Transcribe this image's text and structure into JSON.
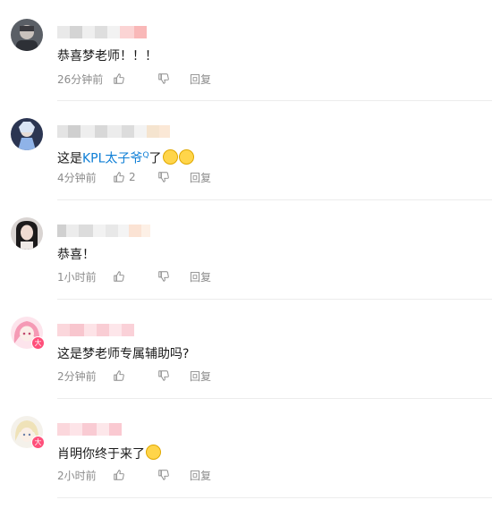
{
  "comments": [
    {
      "text": "恭喜梦老师！！！",
      "time": "26分钟前",
      "likes": "",
      "reply_label": "回复"
    },
    {
      "text_prefix": "这是",
      "link_text": "KPL太子爷",
      "link_sup": "Q",
      "text_suffix": "了",
      "emojis": [
        "smiling-emoji",
        "smiling-emoji"
      ],
      "time": "4分钟前",
      "likes": "2",
      "reply_label": "回复"
    },
    {
      "text": "恭喜！",
      "time": "1小时前",
      "likes": "",
      "reply_label": "回复"
    },
    {
      "text": "这是梦老师专属辅助吗?",
      "time": "2分钟前",
      "likes": "",
      "reply_label": "回复",
      "badge": "大"
    },
    {
      "text": "肖明你终于来了",
      "emojis": [
        "shocked-emoji"
      ],
      "time": "2小时前",
      "likes": "",
      "reply_label": "回复",
      "badge": "大"
    }
  ],
  "colors": {
    "link": "#0f7fd6",
    "meta": "#8c8c8c",
    "badge": "#ff4f7a"
  }
}
